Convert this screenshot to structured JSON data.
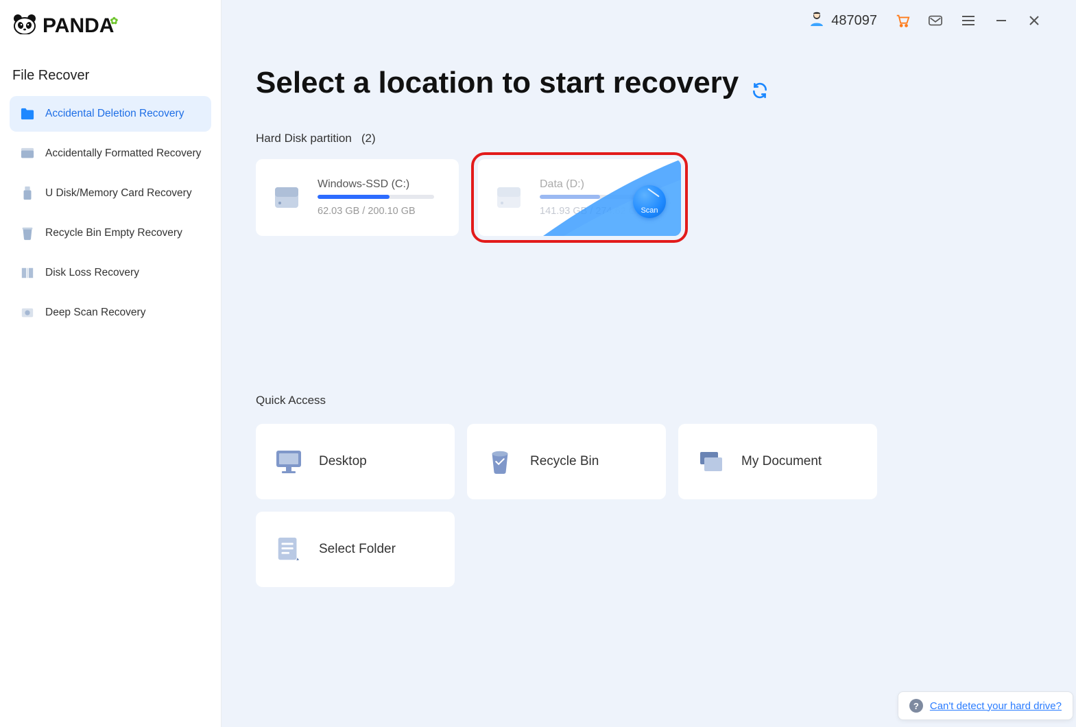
{
  "brand": {
    "name": "PANDA"
  },
  "sidebar": {
    "section_title": "File Recover",
    "items": [
      {
        "label": "Accidental Deletion Recovery",
        "active": true
      },
      {
        "label": "Accidentally Formatted Recovery"
      },
      {
        "label": "U Disk/Memory Card Recovery"
      },
      {
        "label": "Recycle Bin Empty Recovery"
      },
      {
        "label": "Disk Loss Recovery"
      },
      {
        "label": "Deep Scan Recovery"
      }
    ]
  },
  "topbar": {
    "user_id": "487097"
  },
  "main": {
    "page_title": "Select a location to start recovery",
    "hd_section_label": "Hard Disk partition",
    "hd_count": "(2)",
    "partitions": [
      {
        "name": "Windows-SSD   (C:)",
        "usage_text": "62.03 GB / 200.10 GB",
        "fill_pct": 62,
        "highlighted": false,
        "hovered": false
      },
      {
        "name": "Data   (D:)",
        "usage_text": "141.93 GB / 274.62 GB",
        "fill_pct": 52,
        "highlighted": true,
        "hovered": true,
        "scan_label": "Scan"
      }
    ],
    "quick_access_title": "Quick Access",
    "quick_access": [
      {
        "label": "Desktop"
      },
      {
        "label": "Recycle Bin"
      },
      {
        "label": "My Document"
      },
      {
        "label": "Select Folder"
      }
    ],
    "help_link": "Can't detect your hard drive?"
  },
  "colors": {
    "accent": "#1e88ff",
    "highlight_border": "#e21b1b",
    "cart": "#ff7b1a"
  }
}
